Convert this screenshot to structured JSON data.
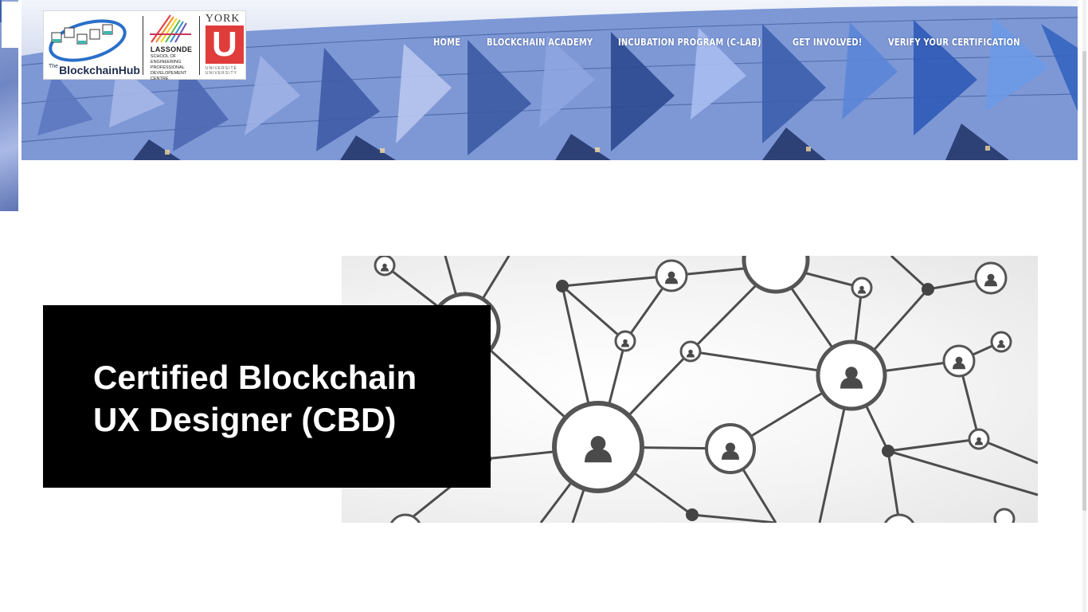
{
  "header": {
    "logo": {
      "blockchainhub_prefix": "The",
      "blockchainhub_name": "BlockchainHub",
      "lassonde_name": "LASSONDE",
      "lassonde_sub": "SCHOOL OF ENGINEERING PROFESSIONAL DEVELOPEMENT CENTRE",
      "york_word": "YORK",
      "york_letter": "U",
      "york_university": "UNIVERSITÉ UNIVERSITY"
    },
    "nav": [
      {
        "label": "HOME"
      },
      {
        "label": "BLOCKCHAIN ACADEMY"
      },
      {
        "label": "INCUBATION PROGRAM (C-LAB)"
      },
      {
        "label": "GET INVOLVED!"
      },
      {
        "label": "VERIFY YOUR CERTIFICATION"
      }
    ]
  },
  "hero": {
    "title_line1": "Certified Blockchain",
    "title_line2": "UX Designer (CBD)"
  },
  "colors": {
    "card_background": "#000000",
    "york_red": "#e03c3c",
    "nav_text": "#ffffff"
  },
  "icons": [
    "network-graph-image",
    "person-icon",
    "building-facade-image"
  ]
}
